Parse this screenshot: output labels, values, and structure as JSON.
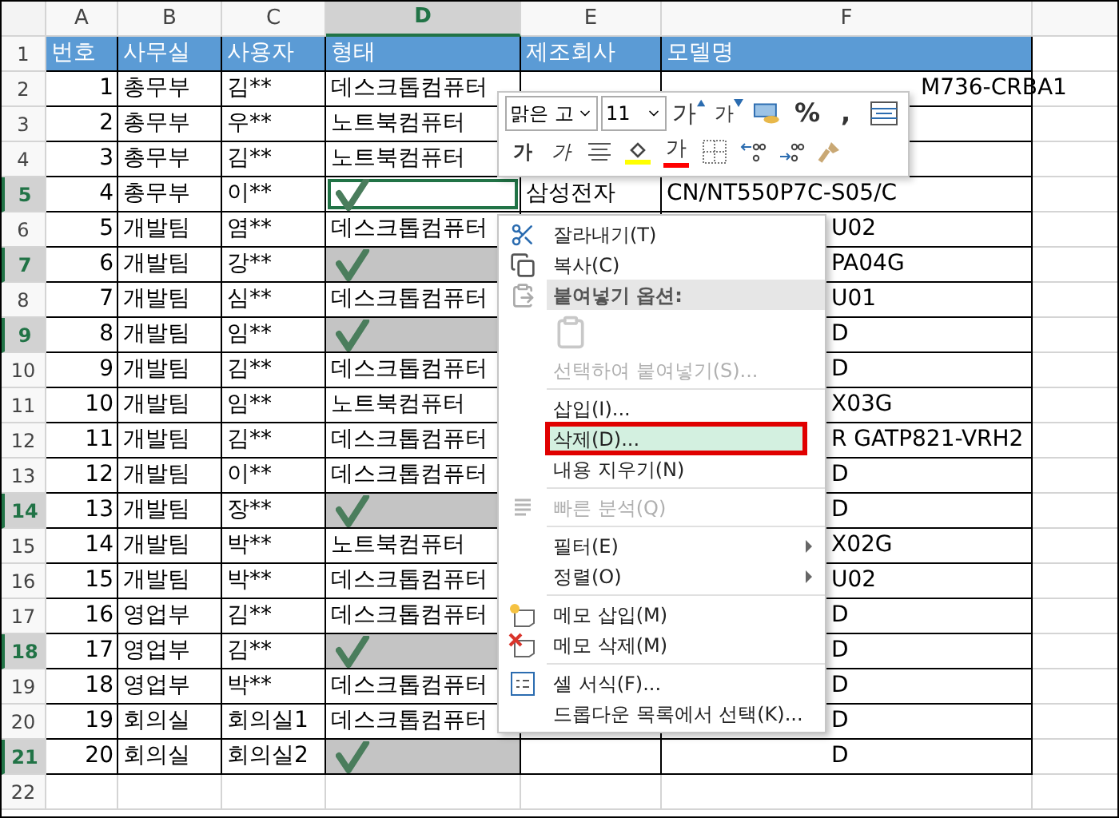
{
  "columns": [
    {
      "label": "A",
      "selected": false
    },
    {
      "label": "B",
      "selected": false
    },
    {
      "label": "C",
      "selected": false
    },
    {
      "label": "D",
      "selected": true
    },
    {
      "label": "E",
      "selected": false
    },
    {
      "label": "F",
      "selected": false
    }
  ],
  "rows": [
    {
      "kind": "header",
      "header": "1",
      "selected": false,
      "active": false,
      "checked": false,
      "cells": [
        "번호",
        "사무실",
        "사용자",
        "형태",
        "제조회사",
        "모델명"
      ]
    },
    {
      "kind": "data",
      "header": "2",
      "selected": false,
      "active": false,
      "checked": false,
      "cells": [
        "1",
        "총무부",
        "김**",
        "데스크톱컴퓨터",
        null,
        "M736-CRBA1"
      ]
    },
    {
      "kind": "data",
      "header": "3",
      "selected": false,
      "active": false,
      "checked": false,
      "cells": [
        "2",
        "총무부",
        "우**",
        "노트북컴퓨터",
        null,
        null
      ]
    },
    {
      "kind": "data",
      "header": "4",
      "selected": false,
      "active": false,
      "checked": false,
      "cells": [
        "3",
        "총무부",
        "김**",
        "노트북컴퓨터",
        null,
        null
      ]
    },
    {
      "kind": "data",
      "header": "5",
      "selected": true,
      "active": true,
      "checked": true,
      "cells": [
        "4",
        "총무부",
        "이**",
        null,
        "삼성전자",
        "CN/NT550P7C-S05/C"
      ]
    },
    {
      "kind": "data",
      "header": "6",
      "selected": false,
      "active": false,
      "checked": false,
      "cells": [
        "5",
        "개발팀",
        "염**",
        "데스크톱컴퓨터",
        null,
        "U02"
      ]
    },
    {
      "kind": "data",
      "header": "7",
      "selected": true,
      "active": false,
      "checked": true,
      "cells": [
        "6",
        "개발팀",
        "강**",
        null,
        null,
        "PA04G"
      ]
    },
    {
      "kind": "data",
      "header": "8",
      "selected": false,
      "active": false,
      "checked": false,
      "cells": [
        "7",
        "개발팀",
        "심**",
        "데스크톱컴퓨터",
        null,
        "U01"
      ]
    },
    {
      "kind": "data",
      "header": "9",
      "selected": true,
      "active": false,
      "checked": true,
      "cells": [
        "8",
        "개발팀",
        "임**",
        null,
        null,
        "D"
      ]
    },
    {
      "kind": "data",
      "header": "10",
      "selected": false,
      "active": false,
      "checked": false,
      "cells": [
        "9",
        "개발팀",
        "김**",
        "데스크톱컴퓨터",
        null,
        "D"
      ]
    },
    {
      "kind": "data",
      "header": "11",
      "selected": false,
      "active": false,
      "checked": false,
      "cells": [
        "10",
        "개발팀",
        "임**",
        "노트북컴퓨터",
        null,
        "X03G"
      ]
    },
    {
      "kind": "data",
      "header": "12",
      "selected": false,
      "active": false,
      "checked": false,
      "cells": [
        "11",
        "개발팀",
        "김**",
        "데스크톱컴퓨터",
        null,
        "R GATP821-VRH2"
      ]
    },
    {
      "kind": "data",
      "header": "13",
      "selected": false,
      "active": false,
      "checked": false,
      "cells": [
        "12",
        "개발팀",
        "이**",
        "데스크톱컴퓨터",
        null,
        "D"
      ]
    },
    {
      "kind": "data",
      "header": "14",
      "selected": true,
      "active": false,
      "checked": true,
      "cells": [
        "13",
        "개발팀",
        "장**",
        null,
        null,
        "D"
      ]
    },
    {
      "kind": "data",
      "header": "15",
      "selected": false,
      "active": false,
      "checked": false,
      "cells": [
        "14",
        "개발팀",
        "박**",
        "노트북컴퓨터",
        null,
        "X02G"
      ]
    },
    {
      "kind": "data",
      "header": "16",
      "selected": false,
      "active": false,
      "checked": false,
      "cells": [
        "15",
        "개발팀",
        "박**",
        "데스크톱컴퓨터",
        null,
        "U02"
      ]
    },
    {
      "kind": "data",
      "header": "17",
      "selected": false,
      "active": false,
      "checked": false,
      "cells": [
        "16",
        "영업부",
        "김**",
        "데스크톱컴퓨터",
        null,
        "D"
      ]
    },
    {
      "kind": "data",
      "header": "18",
      "selected": true,
      "active": false,
      "checked": true,
      "cells": [
        "17",
        "영업부",
        "김**",
        null,
        null,
        "D"
      ]
    },
    {
      "kind": "data",
      "header": "19",
      "selected": false,
      "active": false,
      "checked": false,
      "cells": [
        "18",
        "영업부",
        "박**",
        "데스크톱컴퓨터",
        null,
        "D"
      ]
    },
    {
      "kind": "data",
      "header": "20",
      "selected": false,
      "active": false,
      "checked": false,
      "cells": [
        "19",
        "회의실",
        "회의실1",
        "데스크톱컴퓨터",
        null,
        "D"
      ]
    },
    {
      "kind": "data",
      "header": "21",
      "selected": true,
      "active": false,
      "checked": true,
      "cells": [
        "20",
        "회의실",
        "회의실2",
        null,
        null,
        "D"
      ]
    },
    {
      "kind": "empty",
      "header": "22",
      "selected": false,
      "active": false,
      "checked": false
    }
  ],
  "mini_toolbar": {
    "font": "맑은 고",
    "size": "11",
    "row_1": [
      {
        "kind": "grow",
        "label": "가"
      },
      {
        "kind": "shrink",
        "label": "가"
      },
      {
        "kind": "accounting"
      },
      {
        "kind": "text",
        "label": "%"
      },
      {
        "kind": "text",
        "label": ","
      },
      {
        "kind": "merge"
      }
    ],
    "row_2": [
      {
        "kind": "bold",
        "label": "가"
      },
      {
        "kind": "italic",
        "label": "가"
      },
      {
        "kind": "align"
      },
      {
        "kind": "fill",
        "color": "#ffff00"
      },
      {
        "kind": "font-color",
        "label": "가",
        "color": "#ff0000"
      },
      {
        "kind": "borders"
      },
      {
        "kind": "increase-decimal"
      },
      {
        "kind": "decrease-decimal"
      },
      {
        "kind": "painter"
      }
    ]
  },
  "context_menu": [
    {
      "kind": "command",
      "label": "잘라내기(T)",
      "disabled": false,
      "selected": false,
      "submenu": false
    },
    {
      "kind": "command",
      "label": "복사(C)",
      "disabled": false,
      "selected": false,
      "submenu": false
    },
    {
      "kind": "header",
      "label": "붙여넣기 옵션:"
    },
    {
      "kind": "paste-options"
    },
    {
      "kind": "command",
      "label": "선택하여 붙여넣기(S)...",
      "disabled": true,
      "selected": false,
      "submenu": false
    },
    {
      "kind": "separator"
    },
    {
      "kind": "command",
      "label": "삽입(I)...",
      "disabled": false,
      "selected": false,
      "submenu": false
    },
    {
      "kind": "command",
      "label": "삭제(D)...",
      "disabled": false,
      "selected": true,
      "submenu": false
    },
    {
      "kind": "command",
      "label": "내용 지우기(N)",
      "disabled": false,
      "selected": false,
      "submenu": false
    },
    {
      "kind": "separator"
    },
    {
      "kind": "command",
      "label": "빠른 분석(Q)",
      "disabled": true,
      "selected": false,
      "submenu": false
    },
    {
      "kind": "separator"
    },
    {
      "kind": "command",
      "label": "필터(E)",
      "disabled": false,
      "selected": false,
      "submenu": true
    },
    {
      "kind": "command",
      "label": "정렬(O)",
      "disabled": false,
      "selected": false,
      "submenu": true
    },
    {
      "kind": "separator"
    },
    {
      "kind": "command",
      "label": "메모 삽입(M)",
      "disabled": false,
      "selected": false,
      "submenu": false
    },
    {
      "kind": "command",
      "label": "메모 삭제(M)",
      "disabled": false,
      "selected": false,
      "submenu": false
    },
    {
      "kind": "separator"
    },
    {
      "kind": "command",
      "label": "셀 서식(F)...",
      "disabled": false,
      "selected": false,
      "submenu": false
    },
    {
      "kind": "command",
      "label": "드롭다운 목록에서 선택(K)...",
      "disabled": false,
      "selected": false,
      "submenu": false
    }
  ]
}
